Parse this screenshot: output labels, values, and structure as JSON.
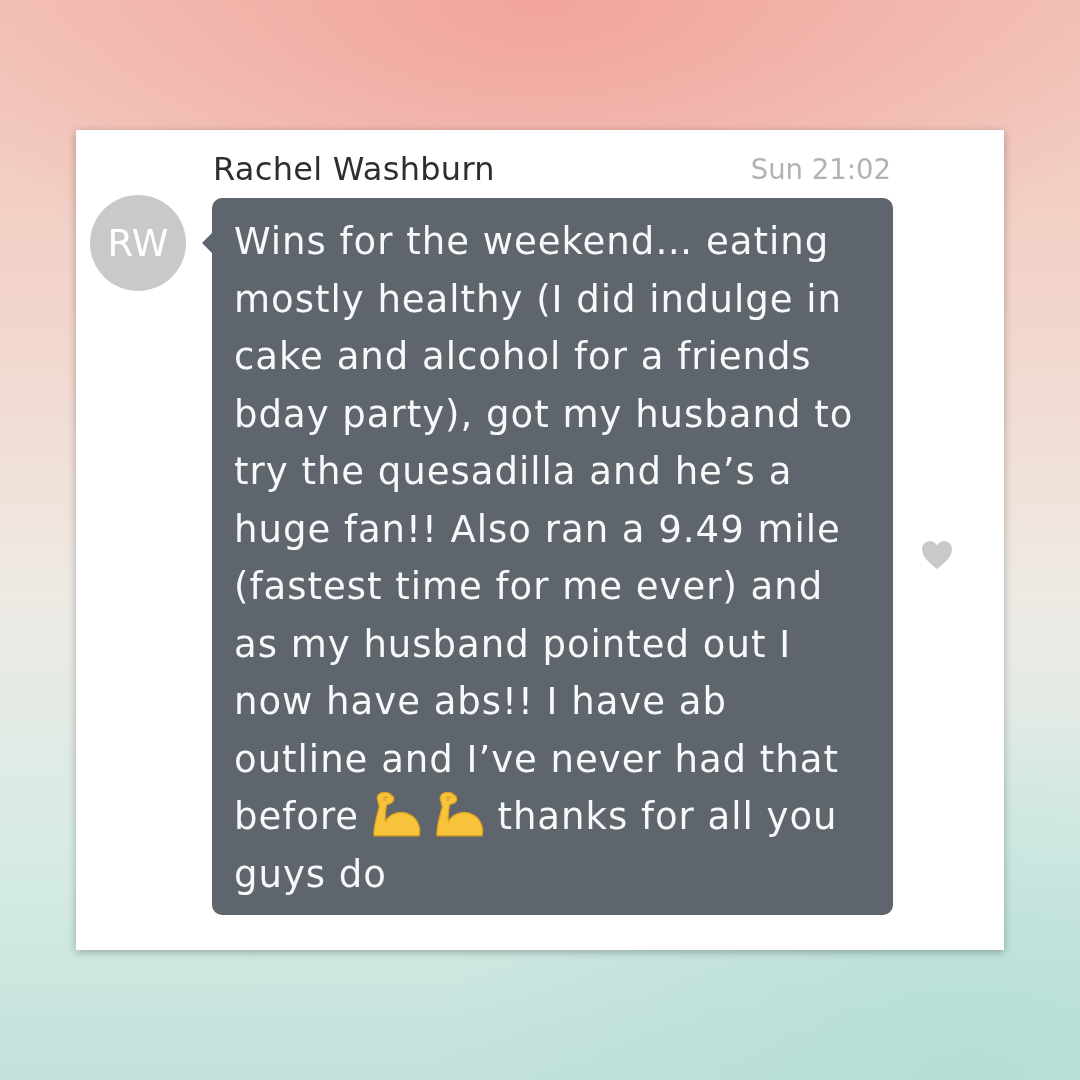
{
  "message": {
    "sender": "Rachel Washburn",
    "time": "Sun 21:02",
    "avatar_initials": "RW",
    "parts": [
      {
        "kind": "text",
        "text": "Wins for the weekend… eating mostly healthy (I did indulge in cake and alcohol for a friends bday party), got my husband to try the quesadilla and he’s a huge fan!! Also ran a 9.49 mile (fastest time for me ever) and as my husband pointed out I now have abs!! I have ab outline and I’ve never had that before"
      },
      {
        "kind": "emoji"
      },
      {
        "kind": "emoji"
      },
      {
        "kind": "text",
        "text": "thanks for all you guys do"
      }
    ]
  }
}
